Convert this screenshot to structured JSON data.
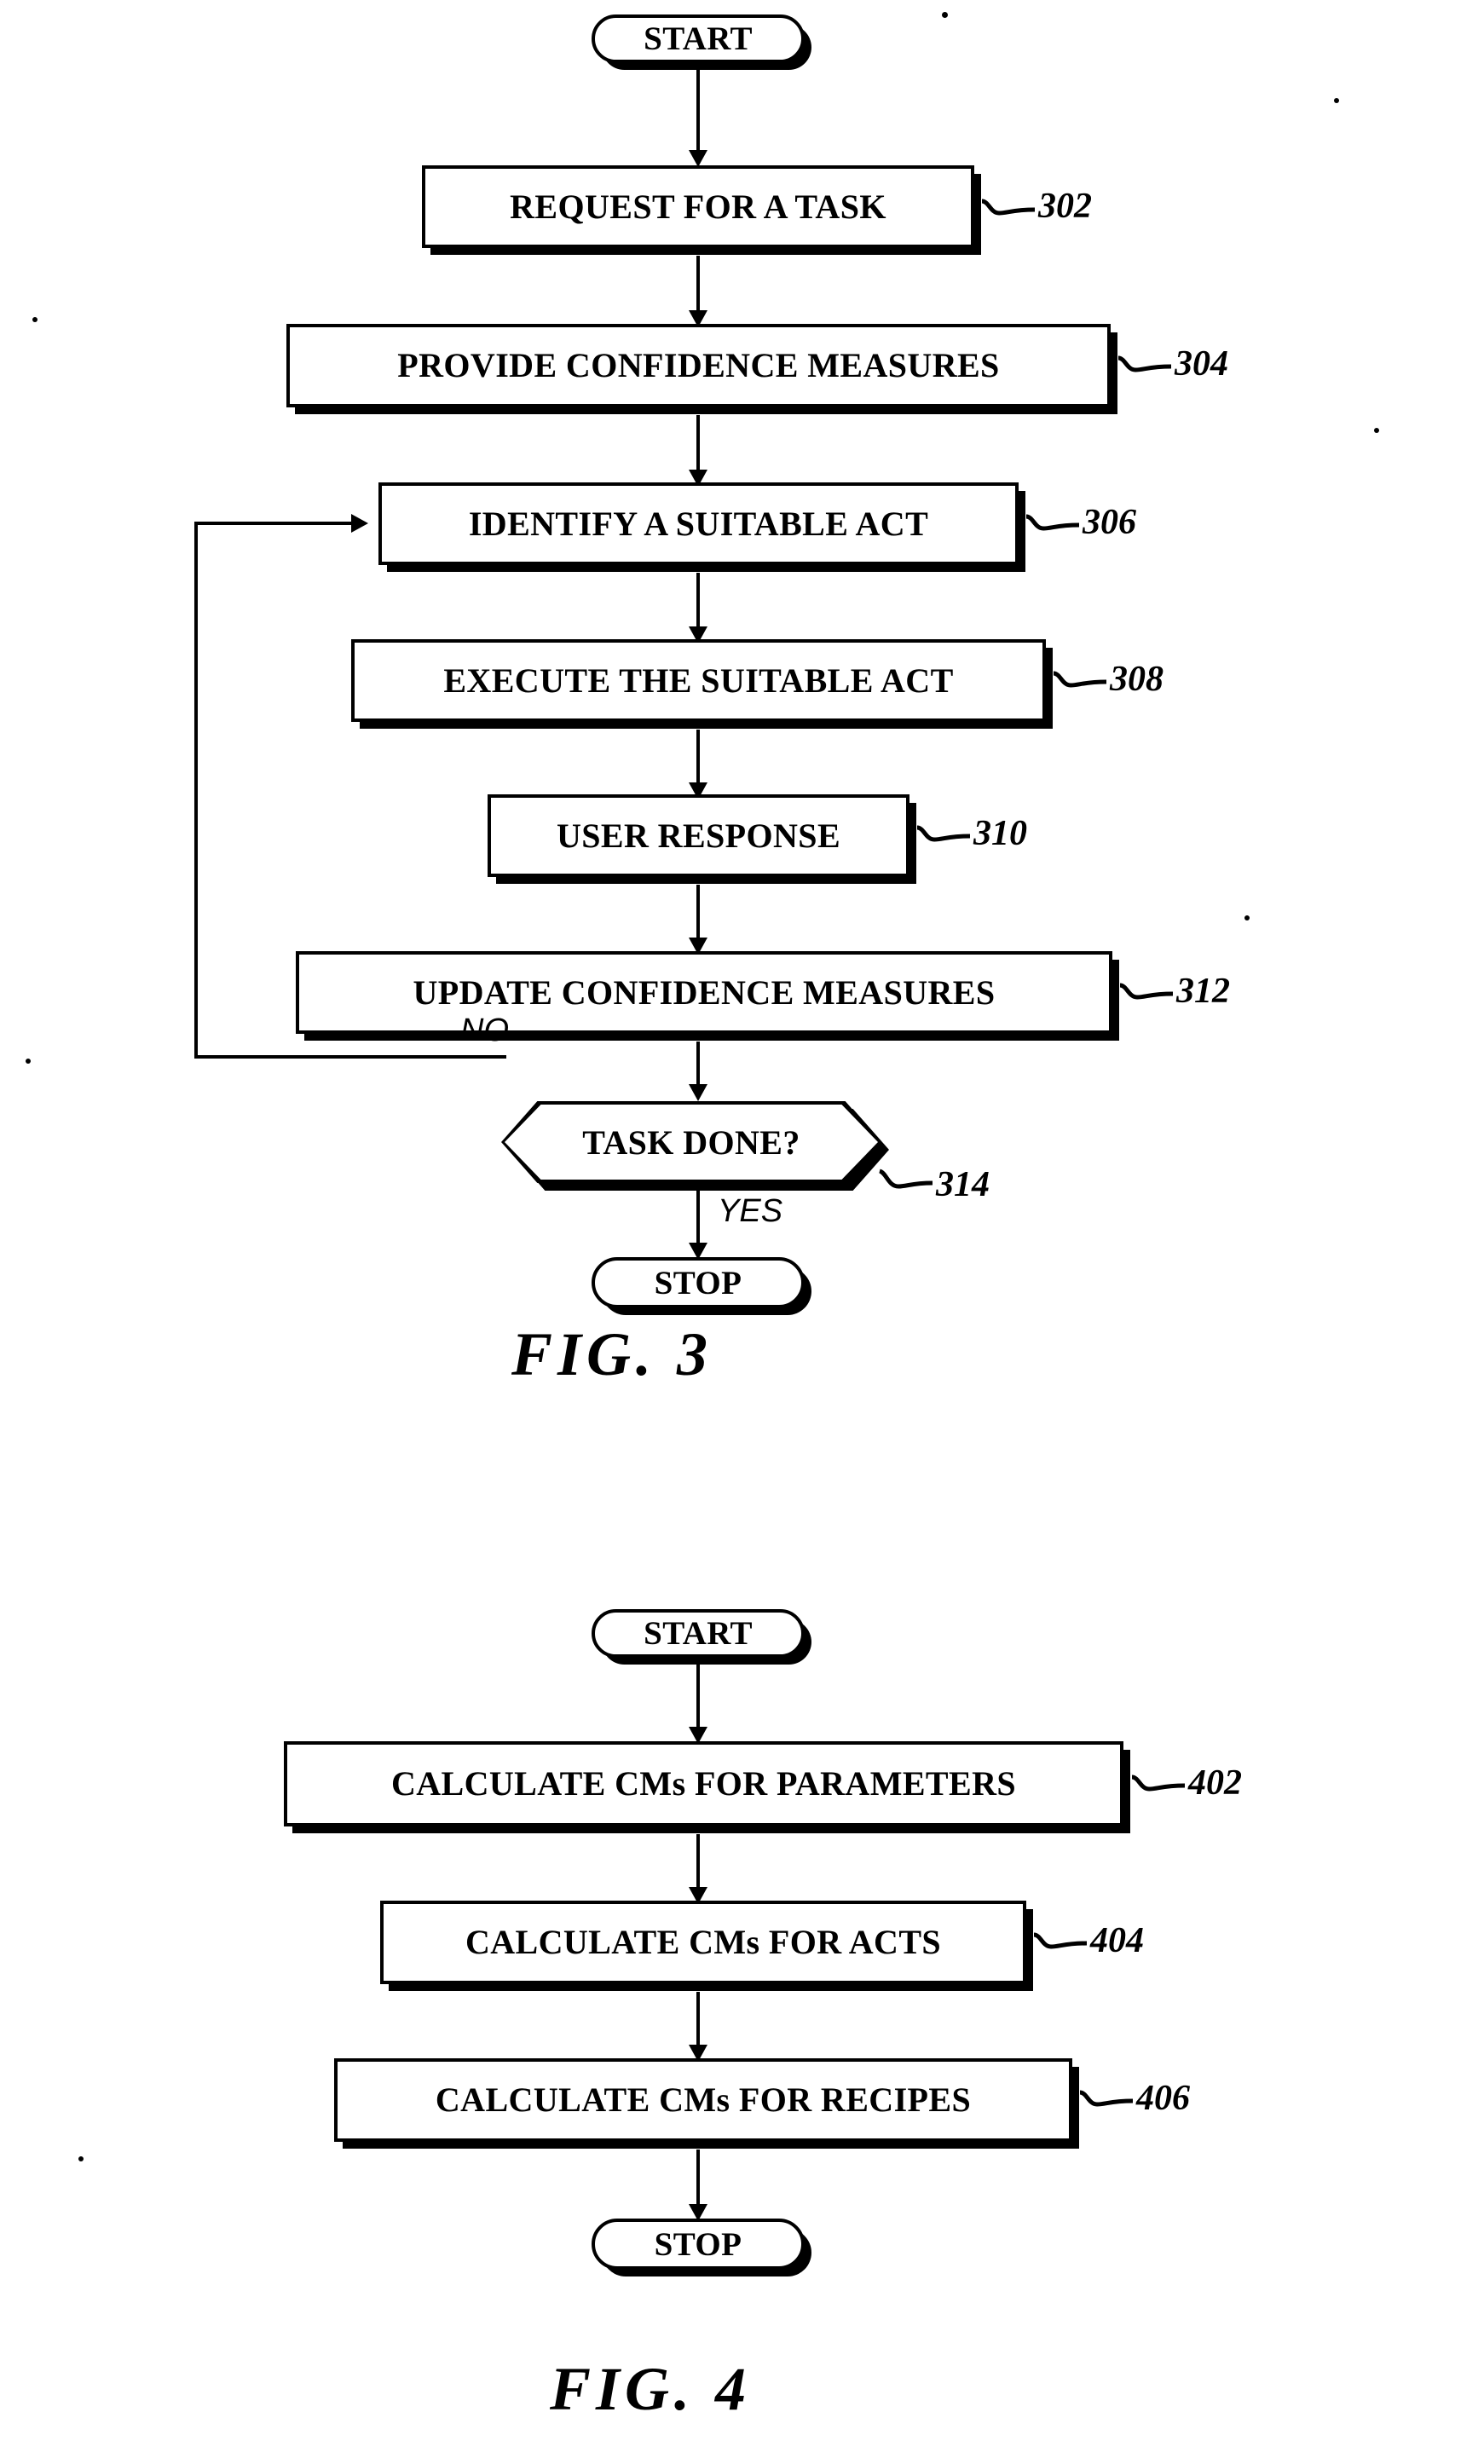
{
  "document": {
    "kind": "patent-drawing-sheet",
    "background_color": "#ffffff",
    "ink_color": "#000000"
  },
  "figures": [
    {
      "id": "fig-3",
      "caption": "FIG. 3",
      "terminals": {
        "start_label": "START",
        "stop_label": "STOP"
      },
      "steps": [
        {
          "ref": "302",
          "label": "REQUEST FOR A TASK"
        },
        {
          "ref": "304",
          "label": "PROVIDE CONFIDENCE MEASURES"
        },
        {
          "ref": "306",
          "label": "IDENTIFY A SUITABLE ACT"
        },
        {
          "ref": "308",
          "label": "EXECUTE THE SUITABLE ACT"
        },
        {
          "ref": "310",
          "label": "USER RESPONSE"
        },
        {
          "ref": "312",
          "label": "UPDATE CONFIDENCE MEASURES"
        }
      ],
      "decision": {
        "ref": "314",
        "label": "TASK DONE?",
        "no_label": "NO",
        "yes_label": "YES",
        "no_target": "IDENTIFY A SUITABLE ACT",
        "yes_target": "STOP"
      }
    },
    {
      "id": "fig-4",
      "caption": "FIG. 4",
      "terminals": {
        "start_label": "START",
        "stop_label": "STOP"
      },
      "steps": [
        {
          "ref": "402",
          "label": "CALCULATE CMs FOR PARAMETERS"
        },
        {
          "ref": "404",
          "label": "CALCULATE CMs FOR ACTS"
        },
        {
          "ref": "406",
          "label": "CALCULATE CMs FOR RECIPES"
        }
      ]
    }
  ]
}
